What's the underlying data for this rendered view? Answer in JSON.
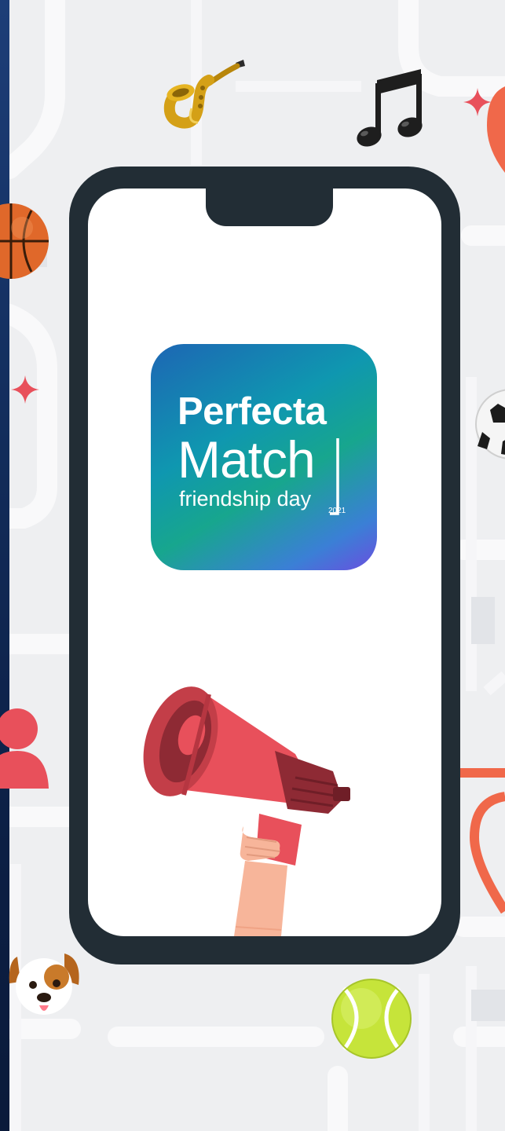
{
  "app_icon": {
    "line1": "Perfecta",
    "line2": "Match",
    "line3": "friendship day",
    "year": "2021"
  },
  "colors": {
    "background": "#eeeff1",
    "phone_frame": "#222d35",
    "screen": "#ffffff",
    "accent_red": "#e8505b",
    "accent_orange": "#f0684a"
  },
  "icons": [
    "saxophone-icon",
    "music-note-icon",
    "basketball-icon",
    "soccer-ball-icon",
    "sparkle-icon",
    "person-icon",
    "map-pin-icon",
    "dog-face-icon",
    "tennis-ball-icon",
    "megaphone-icon"
  ]
}
